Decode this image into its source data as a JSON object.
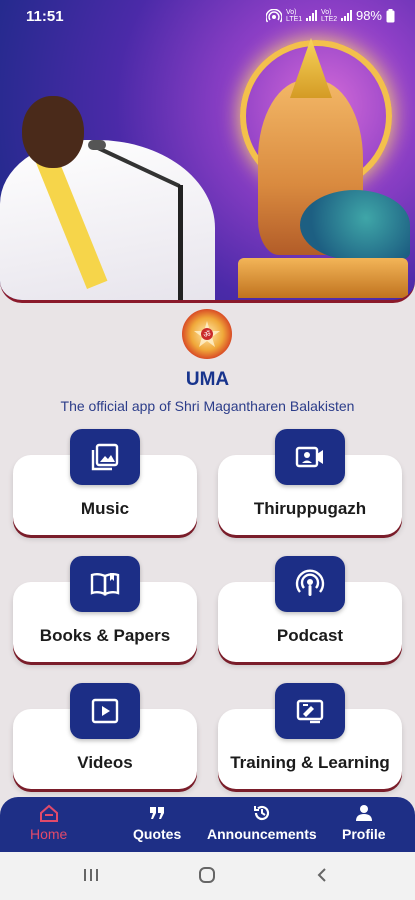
{
  "status": {
    "time": "11:51",
    "battery": "98%",
    "lte1": "Vo) LTE1",
    "lte2": "Vo) LTE2"
  },
  "app": {
    "name": "UMA",
    "tagline": "The official app of Shri Magantharen Balakisten"
  },
  "menu": {
    "music": "Music",
    "thiruppugazh": "Thiruppugazh",
    "books": "Books & Papers",
    "podcast": "Podcast",
    "videos": "Videos",
    "training": "Training & Learning"
  },
  "nav": {
    "home": "Home",
    "quotes": "Quotes",
    "announcements": "Announcements",
    "profile": "Profile",
    "active": "home"
  },
  "colors": {
    "accent": "#1c2e86",
    "active_tab": "#e14a6a",
    "title": "#18348d",
    "card_shadow": "#7a1d2a"
  }
}
